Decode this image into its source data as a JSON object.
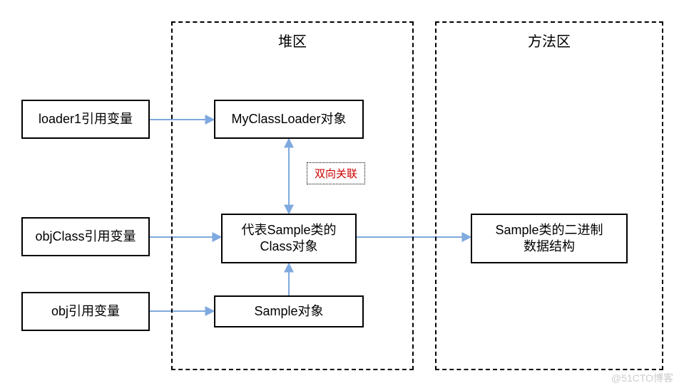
{
  "regions": {
    "heap": {
      "title": "堆区"
    },
    "method": {
      "title": "方法区"
    }
  },
  "boxes": {
    "loader1": "loader1引用变量",
    "objClass": "objClass引用变量",
    "obj": "obj引用变量",
    "myClassLoader": "MyClassLoader对象",
    "classObj": "代表Sample类的\nClass对象",
    "sampleObj": "Sample对象",
    "binary": "Sample类的二进制\n数据结构"
  },
  "annotation": "双向关联",
  "watermark": "@51CTO博客"
}
